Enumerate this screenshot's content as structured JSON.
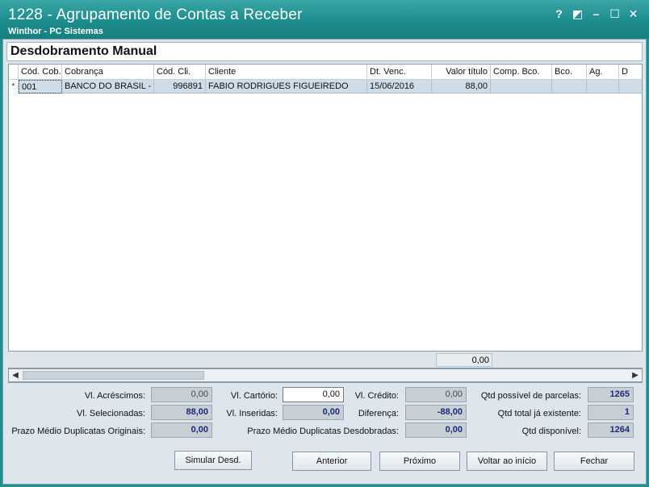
{
  "window": {
    "title": "1228 - Agrupamento de Contas a Receber",
    "subtitle": "Winthor - PC Sistemas",
    "buttons": [
      "?",
      "◩",
      "–",
      "☐",
      "✕"
    ]
  },
  "panel": {
    "title": "Desdobramento Manual"
  },
  "grid": {
    "columns": [
      "Cód. Cob.",
      "Cobrança",
      "Cód. Cli.",
      "Cliente",
      "Dt. Venc.",
      "Valor título",
      "Comp. Bco.",
      "Bco.",
      "Ag.",
      "D"
    ],
    "rows": [
      {
        "marker": "*",
        "cod_cob": "001",
        "cobranca": "BANCO DO BRASIL - CO",
        "cod_cli": "996891",
        "cliente": "FABIO RODRIGUES FIGUEIREDO",
        "dt_venc": "15/06/2016",
        "valor_titulo": "88,00",
        "comp_bco": "",
        "bco": "",
        "ag": "",
        "d": ""
      }
    ],
    "footer_total": "0,00"
  },
  "fields": {
    "vl_acrescimos": {
      "label": "Vl. Acréscimos:",
      "value": "0,00"
    },
    "vl_cartorio": {
      "label": "Vl. Cartório:",
      "value": "0,00"
    },
    "vl_credito": {
      "label": "Vl. Crédito:",
      "value": "0,00"
    },
    "qtd_possivel": {
      "label": "Qtd possível de parcelas:",
      "value": "1265"
    },
    "vl_selecionadas": {
      "label": "Vl. Selecionadas:",
      "value": "88,00"
    },
    "vl_inseridas": {
      "label": "Vl. Inseridas:",
      "value": "0,00"
    },
    "diferenca": {
      "label": "Diferença:",
      "value": "-88,00"
    },
    "qtd_existente": {
      "label": "Qtd total já existente:",
      "value": "1"
    },
    "prazo_originais": {
      "label": "Prazo Médio Duplicatas Originais:",
      "value": "0,00"
    },
    "prazo_desdobradas": {
      "label": "Prazo Médio Duplicatas Desdobradas:",
      "value": "0,00"
    },
    "qtd_disponivel": {
      "label": "Qtd disponível:",
      "value": "1264"
    }
  },
  "buttons": {
    "simular": "Simular Desd.",
    "anterior": "Anterior",
    "proximo": "Próximo",
    "voltar": "Voltar ao início",
    "fechar": "Fechar"
  }
}
